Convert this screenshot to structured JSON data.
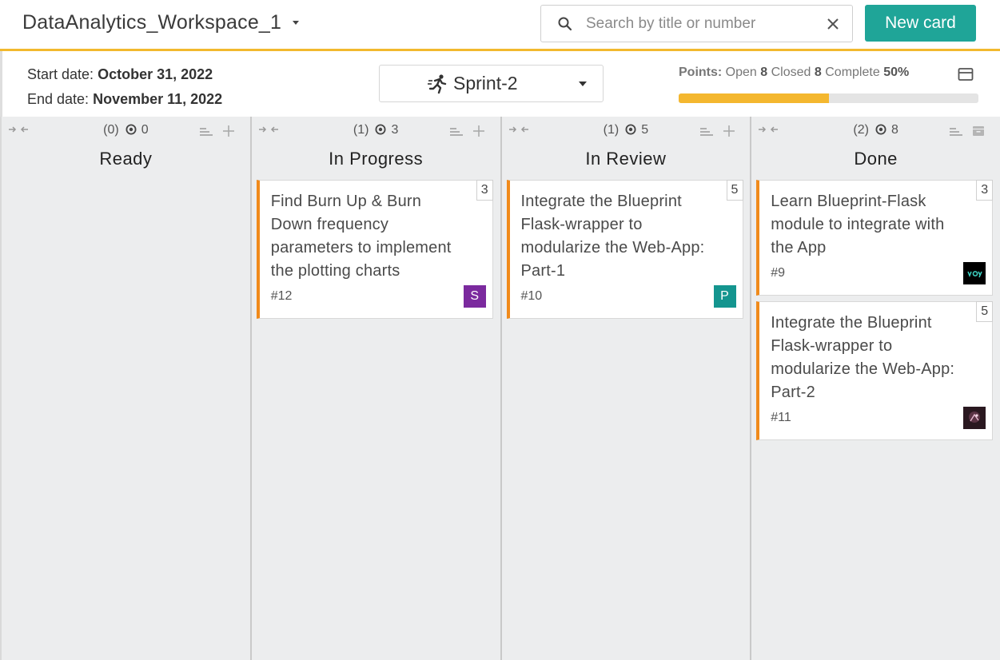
{
  "header": {
    "workspace_name": "DataAnalytics_Workspace_1",
    "search_placeholder": "Search by title or number",
    "search_value": "",
    "new_card_label": "New card",
    "accent_color": "#f2b92e",
    "new_card_color": "#1fa598"
  },
  "sprint": {
    "start_label": "Start date:",
    "start_date": "October 31, 2022",
    "end_label": "End date:",
    "end_date": "November 11, 2022",
    "selected": "Sprint-2",
    "points": {
      "label": "Points:",
      "open_label": "Open",
      "open": "8",
      "closed_label": "Closed",
      "closed": "8",
      "complete_label": "Complete",
      "complete": "50%",
      "complete_fraction": 0.5
    }
  },
  "columns": [
    {
      "title": "Ready",
      "count": "(0)",
      "points": "0",
      "cards": []
    },
    {
      "title": "In Progress",
      "count": "(1)",
      "points": "3",
      "cards": [
        {
          "title": "Find Burn Up & Burn Down frequency parameters to implement the plotting charts",
          "number": "#12",
          "points": "3",
          "avatar_letter": "S",
          "avatar_color": "#7b2a9e"
        }
      ]
    },
    {
      "title": "In Review",
      "count": "(1)",
      "points": "5",
      "cards": [
        {
          "title": "Integrate the Blueprint Flask-wrapper to modularize the Web-App: Part-1",
          "number": "#10",
          "points": "5",
          "avatar_letter": "P",
          "avatar_color": "#14958f"
        }
      ]
    },
    {
      "title": "Done",
      "count": "(2)",
      "points": "8",
      "cards": [
        {
          "title": "Learn Blueprint-Flask module to integrate with the App",
          "number": "#9",
          "points": "3",
          "avatar_letter": "",
          "avatar_color": "#000000"
        },
        {
          "title": "Integrate the Blueprint Flask-wrapper to modularize the Web-App: Part-2",
          "number": "#11",
          "points": "5",
          "avatar_letter": "",
          "avatar_color": "#2a1820"
        }
      ]
    }
  ],
  "icons": {
    "search": "search-icon",
    "clear": "close-icon",
    "sprint": "runner-icon",
    "collapse_panel": "panel-collapse-icon",
    "column_collapse": "collapse-arrows-icon",
    "column_points": "target-icon",
    "column_sort": "sort-icon",
    "column_add": "plus-icon",
    "column_archive": "archive-icon"
  },
  "card_accent_color": "#f08a1b"
}
